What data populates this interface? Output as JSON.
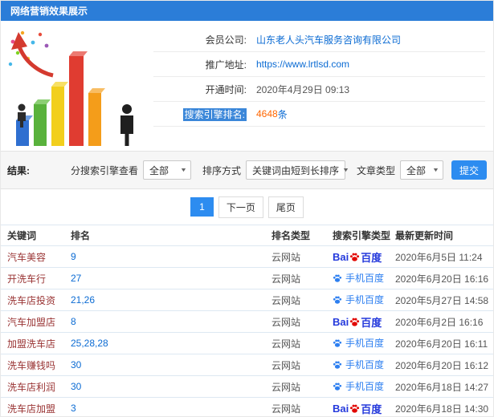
{
  "header": {
    "title": "网络营销效果展示"
  },
  "member": {
    "company_label": "会员公司:",
    "company": "山东老人头汽车服务咨询有限公司",
    "url_label": "推广地址:",
    "url": "https://www.lrtlsd.com",
    "open_time_label": "开通时间:",
    "open_time": "2020年4月29日 09:13",
    "rank_count_label": "搜索引擎排名:",
    "rank_count": "4648",
    "rank_count_unit": "条"
  },
  "filters": {
    "section_label": "结果:",
    "engine_filter_label": "分搜索引擎查看",
    "engine_filter_value": "全部",
    "sort_label": "排序方式",
    "sort_value": "关键词由短到长排序",
    "article_type_label": "文章类型",
    "article_type_value": "全部",
    "submit_label": "提交"
  },
  "pagination": {
    "current": "1",
    "next": "下一页",
    "last": "尾页"
  },
  "engines": {
    "pc": {
      "bai": "Bai",
      "du": "百度"
    },
    "mobile": {
      "label": "手机百度"
    }
  },
  "table": {
    "headers": [
      "关键词",
      "排名",
      "排名类型",
      "搜索引擎类型",
      "最新更新时间"
    ],
    "rows": [
      {
        "keyword": "汽车美容",
        "rank": "9",
        "rank_type": "云网站",
        "engine": "pc",
        "updated": "2020年6月5日 11:24"
      },
      {
        "keyword": "开洗车行",
        "rank": "27",
        "rank_type": "云网站",
        "engine": "mobile",
        "updated": "2020年6月20日 16:16"
      },
      {
        "keyword": "洗车店投资",
        "rank": "21,26",
        "rank_type": "云网站",
        "engine": "mobile",
        "updated": "2020年5月27日 14:58"
      },
      {
        "keyword": "汽车加盟店",
        "rank": "8",
        "rank_type": "云网站",
        "engine": "pc",
        "updated": "2020年6月2日 16:16"
      },
      {
        "keyword": "加盟洗车店",
        "rank": "25,28,28",
        "rank_type": "云网站",
        "engine": "mobile",
        "updated": "2020年6月20日 16:11"
      },
      {
        "keyword": "洗车赚钱吗",
        "rank": "30",
        "rank_type": "云网站",
        "engine": "mobile",
        "updated": "2020年6月20日 16:12"
      },
      {
        "keyword": "洗车店利润",
        "rank": "30",
        "rank_type": "云网站",
        "engine": "mobile",
        "updated": "2020年6月18日 14:27"
      },
      {
        "keyword": "洗车店加盟",
        "rank": "3",
        "rank_type": "云网站",
        "engine": "pc",
        "updated": "2020年6月18日 14:30"
      }
    ]
  },
  "colors": {
    "header_bg": "#2b7dd8",
    "accent_blue": "#2d8cf0",
    "link_blue": "#0b6bd3",
    "count_orange": "#ff6600",
    "keyword_red": "#993333",
    "baidu_blue": "#2439dc",
    "baidu_red": "#e10601",
    "mobile_baidu_blue": "#2d7ff0",
    "highlight_bg": "#3b87d9"
  }
}
